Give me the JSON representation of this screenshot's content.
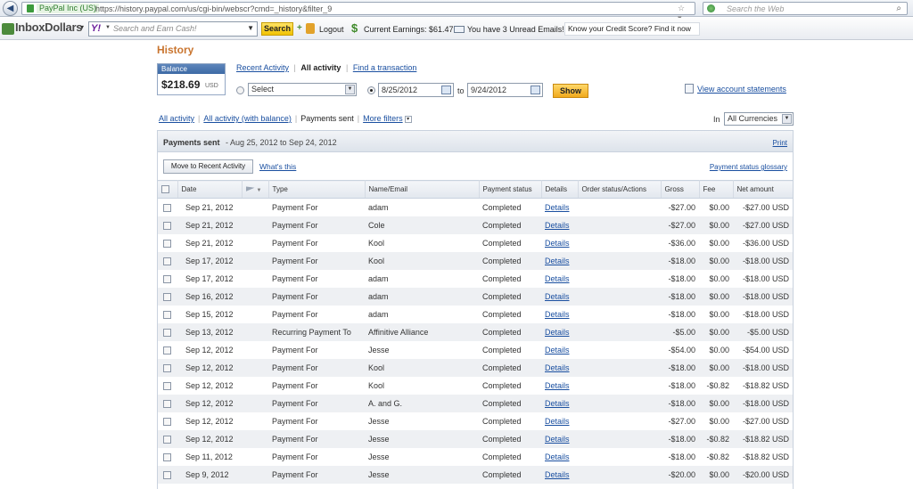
{
  "browser": {
    "site_identity": "PayPal Inc (US)",
    "url": "https://history.paypal.com/us/cgi-bin/webscr?cmd=_history&filter_9",
    "search_placeholder": "Search the Web"
  },
  "toolbar": {
    "logo": "InboxDollars",
    "search_placeholder": "Search and Earn Cash!",
    "search_button": "Search",
    "logout": "Logout",
    "earnings": "Current Earnings: $61.47",
    "unread": "You have 3 Unread Emails!",
    "credit_banner": "Know your Credit Score? Find it now"
  },
  "page": {
    "title": "History",
    "balance_label": "Balance",
    "balance_amount": "$218.69",
    "balance_currency": "USD",
    "tabs": [
      "Recent Activity",
      "All activity",
      "Find a transaction"
    ],
    "select_value": "Select",
    "date_from": "8/25/2012",
    "to_label": "to",
    "date_to": "9/24/2012",
    "show_button": "Show",
    "view_statements": "View account statements",
    "filters": [
      "All activity",
      "All activity (with balance)",
      "Payments sent",
      "More filters"
    ],
    "in_label": "In",
    "currency_select": "All Currencies"
  },
  "panel": {
    "title": "Payments sent",
    "range": "- Aug 25, 2012 to Sep 24, 2012",
    "print": "Print",
    "move_button": "Move to Recent Activity",
    "whats_this": "What's this",
    "glossary": "Payment status glossary"
  },
  "table": {
    "headers": [
      "Date",
      "Type",
      "Name/Email",
      "Payment status",
      "Details",
      "Order status/Actions",
      "Gross",
      "Fee",
      "Net amount"
    ],
    "rows": [
      {
        "date": "Sep 21, 2012",
        "type": "Payment For",
        "name": "adam",
        "status": "Completed",
        "details": "Details",
        "gross": "-$27.00",
        "fee": "$0.00",
        "net": "-$27.00 USD"
      },
      {
        "date": "Sep 21, 2012",
        "type": "Payment For",
        "name": "Cole",
        "status": "Completed",
        "details": "Details",
        "gross": "-$27.00",
        "fee": "$0.00",
        "net": "-$27.00 USD"
      },
      {
        "date": "Sep 21, 2012",
        "type": "Payment For",
        "name": "Kool",
        "status": "Completed",
        "details": "Details",
        "gross": "-$36.00",
        "fee": "$0.00",
        "net": "-$36.00 USD"
      },
      {
        "date": "Sep 17, 2012",
        "type": "Payment For",
        "name": "Kool",
        "status": "Completed",
        "details": "Details",
        "gross": "-$18.00",
        "fee": "$0.00",
        "net": "-$18.00 USD"
      },
      {
        "date": "Sep 17, 2012",
        "type": "Payment For",
        "name": "adam",
        "status": "Completed",
        "details": "Details",
        "gross": "-$18.00",
        "fee": "$0.00",
        "net": "-$18.00 USD"
      },
      {
        "date": "Sep 16, 2012",
        "type": "Payment For",
        "name": "adam",
        "status": "Completed",
        "details": "Details",
        "gross": "-$18.00",
        "fee": "$0.00",
        "net": "-$18.00 USD"
      },
      {
        "date": "Sep 15, 2012",
        "type": "Payment For",
        "name": "adam",
        "status": "Completed",
        "details": "Details",
        "gross": "-$18.00",
        "fee": "$0.00",
        "net": "-$18.00 USD"
      },
      {
        "date": "Sep 13, 2012",
        "type": "Recurring Payment To",
        "name": "Affinitive Alliance",
        "status": "Completed",
        "details": "Details",
        "gross": "-$5.00",
        "fee": "$0.00",
        "net": "-$5.00 USD"
      },
      {
        "date": "Sep 12, 2012",
        "type": "Payment For",
        "name": "Jesse",
        "status": "Completed",
        "details": "Details",
        "gross": "-$54.00",
        "fee": "$0.00",
        "net": "-$54.00 USD"
      },
      {
        "date": "Sep 12, 2012",
        "type": "Payment For",
        "name": "Kool",
        "status": "Completed",
        "details": "Details",
        "gross": "-$18.00",
        "fee": "$0.00",
        "net": "-$18.00 USD"
      },
      {
        "date": "Sep 12, 2012",
        "type": "Payment For",
        "name": "Kool",
        "status": "Completed",
        "details": "Details",
        "gross": "-$18.00",
        "fee": "-$0.82",
        "net": "-$18.82 USD"
      },
      {
        "date": "Sep 12, 2012",
        "type": "Payment For",
        "name": "A. and G.",
        "status": "Completed",
        "details": "Details",
        "gross": "-$18.00",
        "fee": "$0.00",
        "net": "-$18.00 USD"
      },
      {
        "date": "Sep 12, 2012",
        "type": "Payment For",
        "name": "Jesse",
        "status": "Completed",
        "details": "Details",
        "gross": "-$27.00",
        "fee": "$0.00",
        "net": "-$27.00 USD"
      },
      {
        "date": "Sep 12, 2012",
        "type": "Payment For",
        "name": "Jesse",
        "status": "Completed",
        "details": "Details",
        "gross": "-$18.00",
        "fee": "-$0.82",
        "net": "-$18.82 USD"
      },
      {
        "date": "Sep 11, 2012",
        "type": "Payment For",
        "name": "Jesse",
        "status": "Completed",
        "details": "Details",
        "gross": "-$18.00",
        "fee": "-$0.82",
        "net": "-$18.82 USD"
      },
      {
        "date": "Sep 9, 2012",
        "type": "Payment For",
        "name": "Jesse",
        "status": "Completed",
        "details": "Details",
        "gross": "-$20.00",
        "fee": "$0.00",
        "net": "-$20.00 USD"
      }
    ]
  },
  "colors": {
    "title_orange": "#c9752f",
    "link_blue": "#1a4fa0",
    "show_button": "#f0a91c"
  }
}
